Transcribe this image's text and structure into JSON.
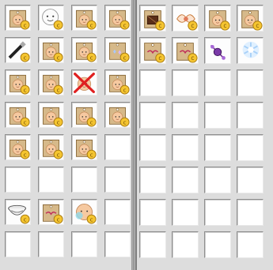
{
  "left_inventory": {
    "columns": 4,
    "rows": 8,
    "slots": [
      "tag-doll-icon",
      "face-doll-icon",
      "tag-doll-icon",
      "tag-doll-icon",
      "brush-tag-icon",
      "tag-doll-icon",
      "tag-doll-icon",
      "sparkle-tag-icon",
      "tag-doll-icon",
      "tag-doll-icon",
      "crossed-out-doll-icon",
      "tag-doll-icon",
      "tag-doll-icon",
      "tag-doll-icon",
      "tag-doll-icon",
      "tag-doll-icon",
      "tag-doll-icon",
      "tag-doll-icon",
      "tag-doll-icon",
      "",
      "",
      "",
      "",
      "",
      "bowl-icon",
      "ribbon-tag-icon",
      "doll-head-icon",
      "",
      "",
      "",
      "",
      ""
    ]
  },
  "right_inventory": {
    "columns": 4,
    "rows": 8,
    "slots": [
      "chocolate-tag-icon",
      "ribbon-icon",
      "tag-doll-icon",
      "tag-doll-icon",
      "ribbon-tag-icon",
      "ribbon-tag-icon",
      "purple-gem-icon",
      "ice-crystal-icon",
      "",
      "",
      "",
      "",
      "",
      "",
      "",
      "",
      "",
      "",
      "",
      "",
      "",
      "",
      "",
      "",
      "",
      "",
      "",
      "",
      "",
      "",
      "",
      ""
    ]
  },
  "colors": {
    "coin": "#f5c530",
    "cross": "#e02020",
    "tag": "#d6b98a",
    "skin": "#f6c9a0"
  }
}
